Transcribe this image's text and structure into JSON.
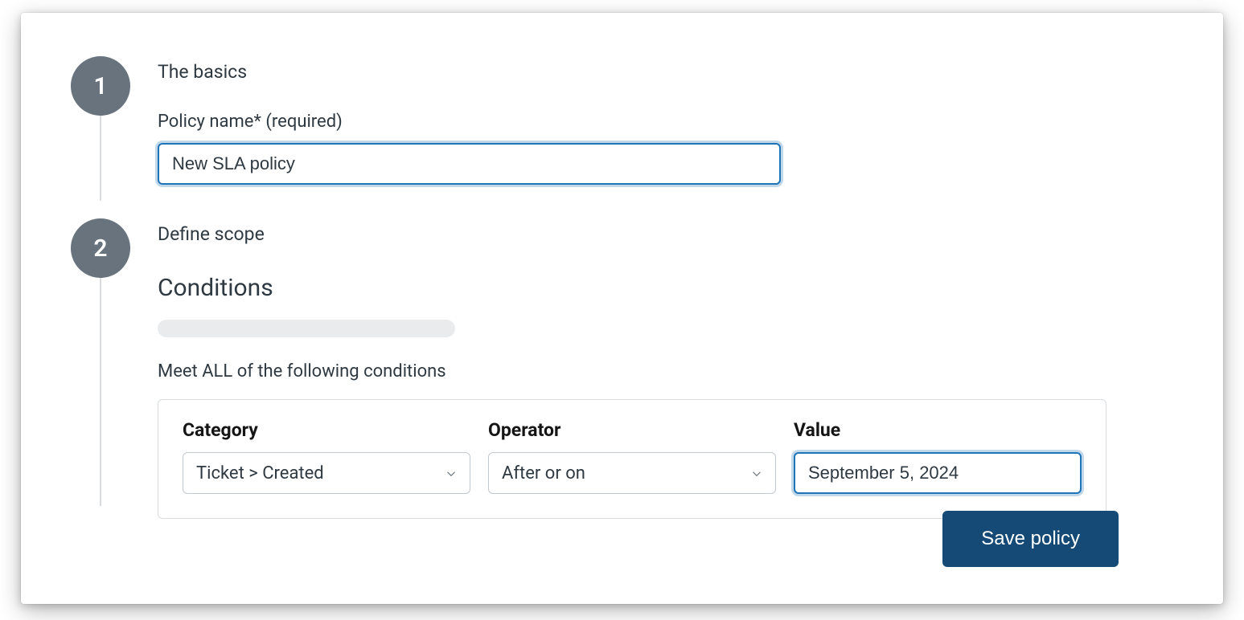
{
  "steps": {
    "step1": {
      "number": "1",
      "title": "The basics",
      "policy_name_label": "Policy name* (required)",
      "policy_name_value": "New SLA policy"
    },
    "step2": {
      "number": "2",
      "title": "Define scope",
      "conditions_heading": "Conditions",
      "conditions_subtitle": "Meet ALL of the following conditions",
      "columns": {
        "category_label": "Category",
        "operator_label": "Operator",
        "value_label": "Value"
      },
      "row": {
        "category": "Ticket > Created",
        "operator": "After or on",
        "value": "September 5, 2024"
      }
    }
  },
  "actions": {
    "save_label": "Save policy"
  }
}
